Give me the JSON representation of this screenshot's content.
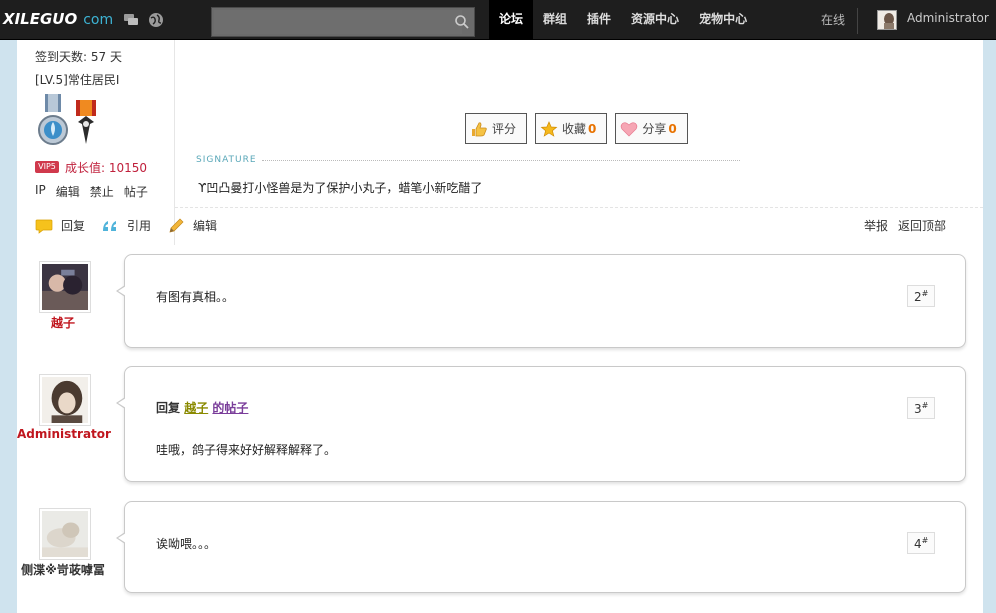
{
  "topbar": {
    "logo_main": "XILEGUO",
    "logo_sub": "com",
    "search_placeholder": "",
    "nav": [
      {
        "label": "论坛",
        "active": true
      },
      {
        "label": "群组",
        "active": false
      },
      {
        "label": "插件",
        "active": false
      },
      {
        "label": "资源中心",
        "active": false
      },
      {
        "label": "宠物中心",
        "active": false
      }
    ],
    "online": "在线",
    "username": "Administrator"
  },
  "profile": {
    "signin_days": "签到天数: 57 天",
    "level": "[LV.5]常住居民I",
    "vip_badge": "VIP5",
    "growth": "成长值: 10150",
    "admin_links": [
      "IP",
      "编辑",
      "禁止",
      "帖子"
    ]
  },
  "post_buttons": {
    "rate": "评分",
    "favorite": "收藏",
    "favorite_count": "0",
    "share": "分享",
    "share_count": "0"
  },
  "signature": {
    "label": "SIGNATURE",
    "text": "ϒ凹凸曼打小怪兽是为了保护小丸子，蜡笔小新吃醋了"
  },
  "actions": {
    "reply": "回复",
    "quote": "引用",
    "edit": "编辑",
    "report": "举报",
    "back_to_top": "返回顶部"
  },
  "replies": [
    {
      "author": "越子",
      "text": "有图有真相。。",
      "floor": "2"
    },
    {
      "author": "Administrator",
      "quote_prefix": "回复",
      "quote_user": "越子",
      "quote_suffix": "的帖子",
      "text": "哇哦，鸽子得来好好解释解释了。",
      "floor": "3"
    },
    {
      "author": "侧渫※岢荍嘑冨",
      "text": "诶呦喂。。。",
      "floor": "4"
    }
  ],
  "colors": {
    "topbar_bg": "#1e1e1e",
    "accent_blue": "#3db3d4",
    "growth_red": "#c0203c",
    "count_orange": "#e87200",
    "page_bg": "#cfe3ee"
  }
}
